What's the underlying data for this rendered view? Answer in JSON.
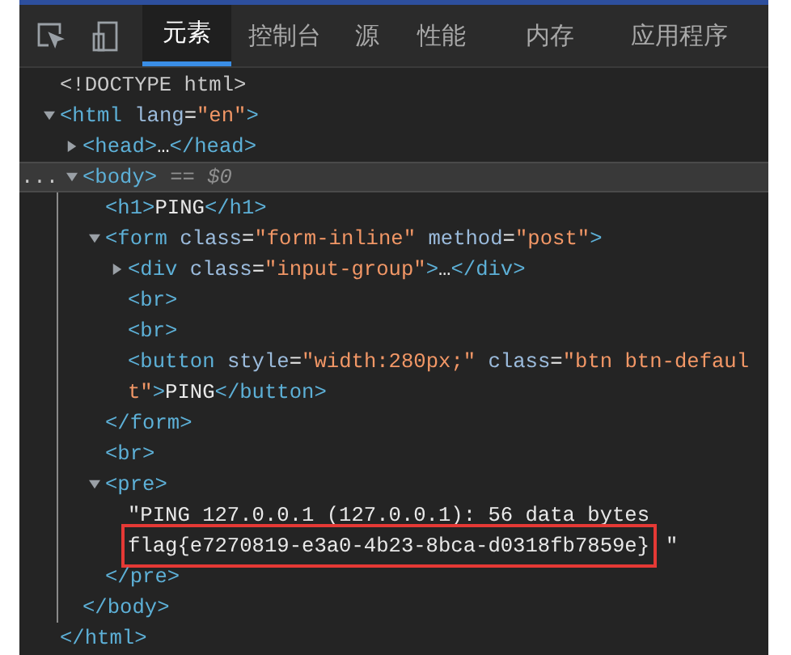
{
  "tabs": [
    {
      "label": "元素",
      "selected": true
    },
    {
      "label": "控制台",
      "selected": false
    },
    {
      "label": "源",
      "selected": false
    },
    {
      "label": "性能",
      "selected": false
    },
    {
      "label": "内存",
      "selected": false
    },
    {
      "label": "应用程序",
      "selected": false
    }
  ],
  "selection_marker": "...",
  "dom_tree": [
    {
      "kind": "doctype",
      "lines": [
        "<!DOCTYPE html>"
      ],
      "selected": false
    },
    {
      "kind": "element",
      "lines": [
        "<html lang=\"en\">"
      ],
      "expanded": true,
      "selected": false,
      "closing": "</html>",
      "children": [
        {
          "kind": "element",
          "lines": [
            "<head>…</head>"
          ],
          "expanded": false,
          "selected": false
        },
        {
          "kind": "element",
          "lines": [
            "<body>"
          ],
          "note": "== $0",
          "expanded": true,
          "selected": true,
          "closing": "</body>",
          "children": [
            {
              "kind": "element",
              "lines": [
                "<h1>PING</h1>"
              ],
              "selected": false
            },
            {
              "kind": "element",
              "lines": [
                "<form class=\"form-inline\" method=\"post\">"
              ],
              "expanded": true,
              "selected": false,
              "closing": "</form>",
              "children": [
                {
                  "kind": "element",
                  "lines": [
                    "<div class=\"input-group\">…</div>"
                  ],
                  "expanded": false,
                  "selected": false
                },
                {
                  "kind": "element",
                  "lines": [
                    "<br>"
                  ],
                  "selected": false
                },
                {
                  "kind": "element",
                  "lines": [
                    "<br>"
                  ],
                  "selected": false
                },
                {
                  "kind": "element",
                  "lines": [
                    "<button style=\"width:280px;\" class=\"btn btn-defaul",
                    "t\">PING</button>"
                  ],
                  "selected": false
                }
              ]
            },
            {
              "kind": "element",
              "lines": [
                "<br>"
              ],
              "selected": false
            },
            {
              "kind": "element",
              "lines": [
                "<pre>"
              ],
              "expanded": true,
              "selected": false,
              "closing": "</pre>",
              "children": [
                {
                  "kind": "text",
                  "lines": [
                    {
                      "text": "\"PING 127.0.0.1 (127.0.0.1): 56 data bytes",
                      "highlighted": false
                    },
                    {
                      "text": "flag{e7270819-e3a0-4b23-8bca-d0318fb7859e}",
                      "highlighted": true,
                      "suffix": "\""
                    }
                  ]
                }
              ]
            }
          ]
        }
      ]
    }
  ]
}
